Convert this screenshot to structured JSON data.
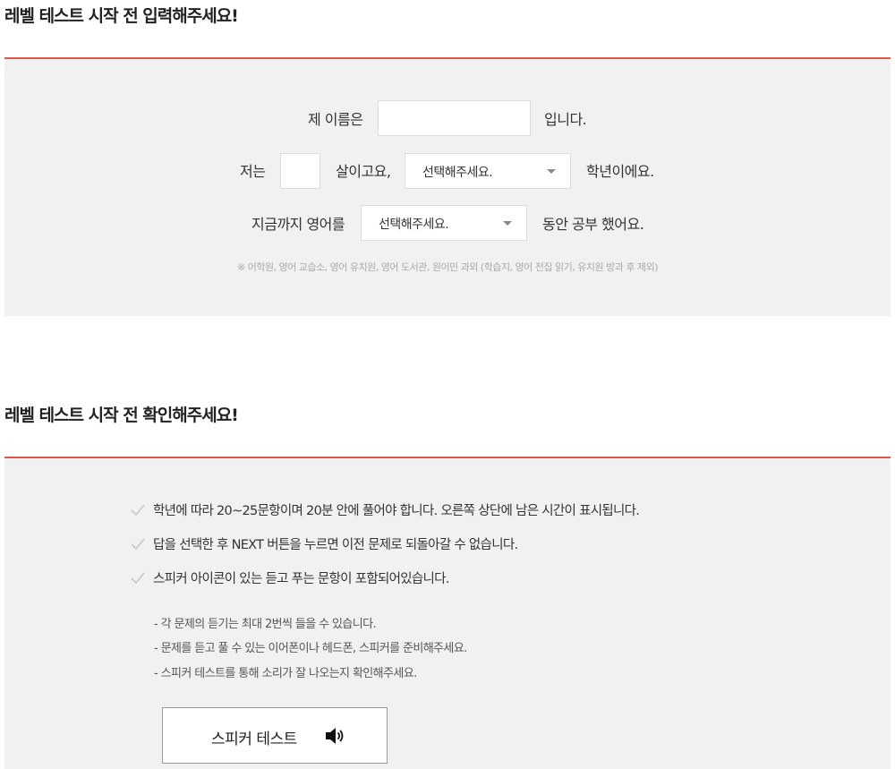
{
  "input_section": {
    "title": "레벨 테스트 시작 전 입력해주세요!",
    "name_row": {
      "prefix": "제 이름은",
      "name_value": "",
      "suffix": "입니다."
    },
    "age_row": {
      "prefix": "저는",
      "age_value": "",
      "middle": "살이고요,",
      "grade_select": "선택해주세요.",
      "suffix": "학년이에요."
    },
    "study_row": {
      "prefix": "지금까지 영어를",
      "period_select": "선택해주세요.",
      "suffix": "동안 공부 했어요."
    },
    "footnote": "※ 어학원, 영어 교습소, 영어 유치원, 영어 도서관, 원어민 과외 (학습지, 영어 전집 읽기, 유치원 방과 후 제외)"
  },
  "confirm_section": {
    "title": "레벨 테스트 시작 전 확인해주세요!",
    "checks": [
      {
        "text": "학년에 따라 20~25문항이며 20분 안에 풀어야 합니다. 오른쪽 상단에 남은 시간이 표시됩니다."
      },
      {
        "text": "답을 선택한 후 NEXT 버튼을 누르면 이전 문제로 되돌아갈 수 없습니다."
      },
      {
        "text": "스피커 아이콘이 있는 듣고 푸는 문항이 포함되어있습니다."
      }
    ],
    "notes": [
      {
        "text": "- 각 문제의 듣기는 최대 2번씩 들을 수 있습니다."
      },
      {
        "text": "- 문제를 듣고 풀 수 있는 이어폰이나 헤드폰, 스피커를 준비해주세요."
      },
      {
        "text": "- 스피커 테스트를 통해 소리가 잘 나오는지 확인해주세요."
      }
    ],
    "speaker_test_label": "스피커 테스트"
  },
  "colors": {
    "accent_rule": "#e2564a",
    "panel_bg": "#f1f1f1",
    "check_icon": "#c8c8c8"
  },
  "icons": {
    "check": "check-icon",
    "speaker": "speaker-icon",
    "dropdown": "chevron-down-icon"
  }
}
